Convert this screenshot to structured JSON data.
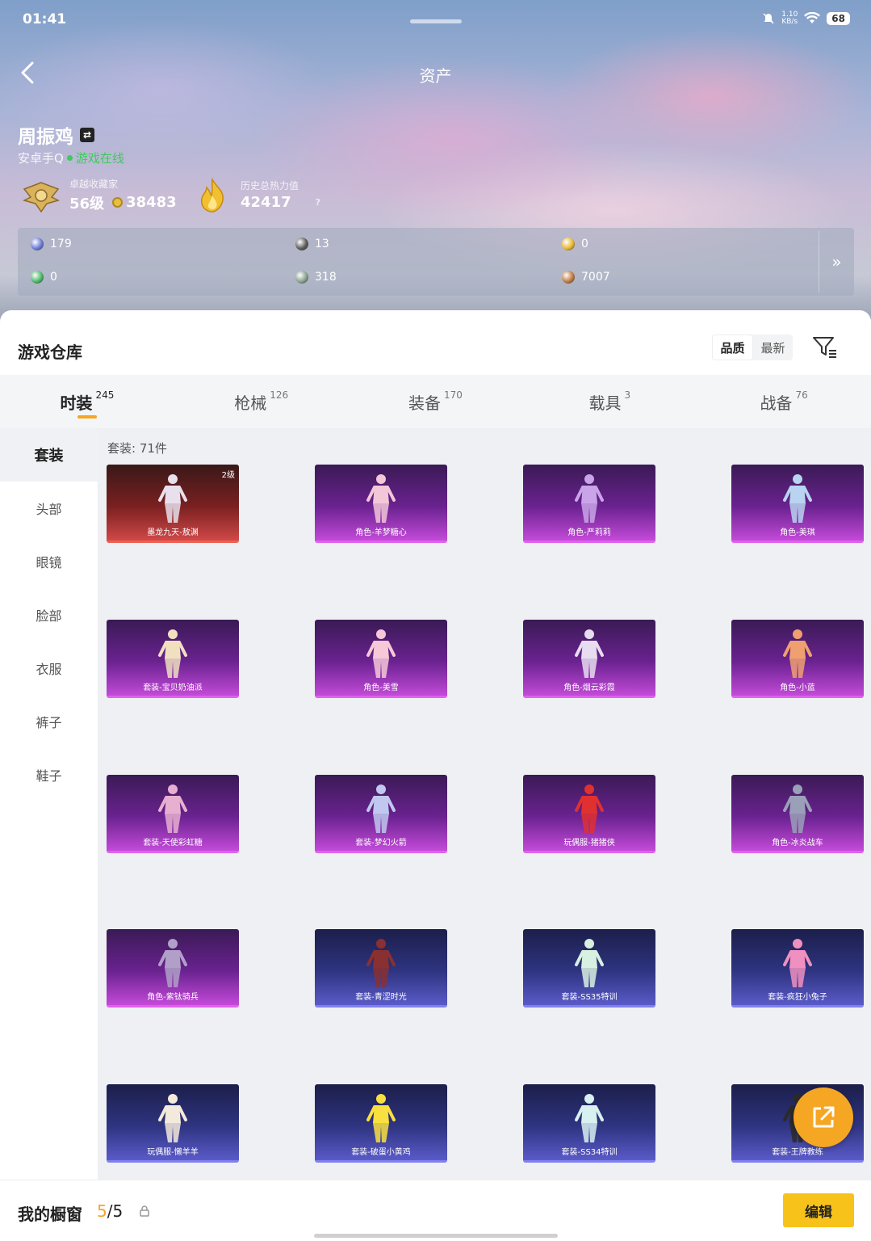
{
  "status": {
    "time": "01:41",
    "net_speed": "1.10",
    "net_unit": "KB/s",
    "battery": "68"
  },
  "header": {
    "title": "资产"
  },
  "player": {
    "name": "周振鸡",
    "platform": "安卓手Q",
    "online_status": "游戏在线",
    "collector_title": "卓越收藏家",
    "level": "56级",
    "coins": "38483",
    "heat_label": "历史总热力值",
    "heat_value": "42417",
    "help": "?"
  },
  "resources": [
    {
      "icon": "card-icon",
      "value": "179",
      "color": "#6b7bd6"
    },
    {
      "icon": "gear-coin-icon",
      "value": "13",
      "color": "#5a5a5a"
    },
    {
      "icon": "gold-coin-icon",
      "value": "0",
      "color": "#e8b830"
    },
    {
      "icon": "green-ticket-icon",
      "value": "0",
      "color": "#4cb86a"
    },
    {
      "icon": "silver-coin-icon",
      "value": "318",
      "color": "#8aa090"
    },
    {
      "icon": "bronze-coin-icon",
      "value": "7007",
      "color": "#c07a40"
    }
  ],
  "warehouse": {
    "title": "游戏仓库",
    "sort_options": [
      "品质",
      "最新"
    ],
    "sort_active": 0
  },
  "tabs": [
    {
      "label": "时装",
      "count": "245"
    },
    {
      "label": "枪械",
      "count": "126"
    },
    {
      "label": "装备",
      "count": "170"
    },
    {
      "label": "载具",
      "count": "3"
    },
    {
      "label": "战备",
      "count": "76"
    }
  ],
  "side_menu": [
    "套装",
    "头部",
    "眼镜",
    "脸部",
    "衣服",
    "裤子",
    "鞋子"
  ],
  "grid": {
    "title": "套装: 71件",
    "items": [
      {
        "label": "墨龙九天-敖渊",
        "rarity": "red",
        "level": "2级"
      },
      {
        "label": "角色-羊梦糖心",
        "rarity": "purple",
        "level": ""
      },
      {
        "label": "角色-严莉莉",
        "rarity": "purple",
        "level": ""
      },
      {
        "label": "角色-美琪",
        "rarity": "purple",
        "level": ""
      },
      {
        "label": "套装-宝贝奶油派",
        "rarity": "purple",
        "level": ""
      },
      {
        "label": "角色-美雪",
        "rarity": "purple",
        "level": ""
      },
      {
        "label": "角色-烟云彩霞",
        "rarity": "purple",
        "level": ""
      },
      {
        "label": "角色-小蓝",
        "rarity": "purple",
        "level": ""
      },
      {
        "label": "套装-天使彩虹糖",
        "rarity": "purple",
        "level": ""
      },
      {
        "label": "套装-梦幻火箭",
        "rarity": "purple",
        "level": ""
      },
      {
        "label": "玩偶服-猪猪侠",
        "rarity": "purple",
        "level": ""
      },
      {
        "label": "角色-冰炎战车",
        "rarity": "purple",
        "level": ""
      },
      {
        "label": "角色-紫钛骑兵",
        "rarity": "purple",
        "level": ""
      },
      {
        "label": "套装-青涩时光",
        "rarity": "blue",
        "level": ""
      },
      {
        "label": "套装-SS35特训",
        "rarity": "blue",
        "level": ""
      },
      {
        "label": "套装-疯狂小兔子",
        "rarity": "blue",
        "level": ""
      },
      {
        "label": "玩偶服-懒羊羊",
        "rarity": "blue",
        "level": ""
      },
      {
        "label": "套装-破蛋小黄鸡",
        "rarity": "blue",
        "level": ""
      },
      {
        "label": "套装-SS34特训",
        "rarity": "blue",
        "level": ""
      },
      {
        "label": "套装-王牌教练",
        "rarity": "blue",
        "level": ""
      }
    ]
  },
  "showcase": {
    "label": "我的橱窗",
    "current": "5",
    "total": "/5",
    "edit_label": "编辑"
  }
}
